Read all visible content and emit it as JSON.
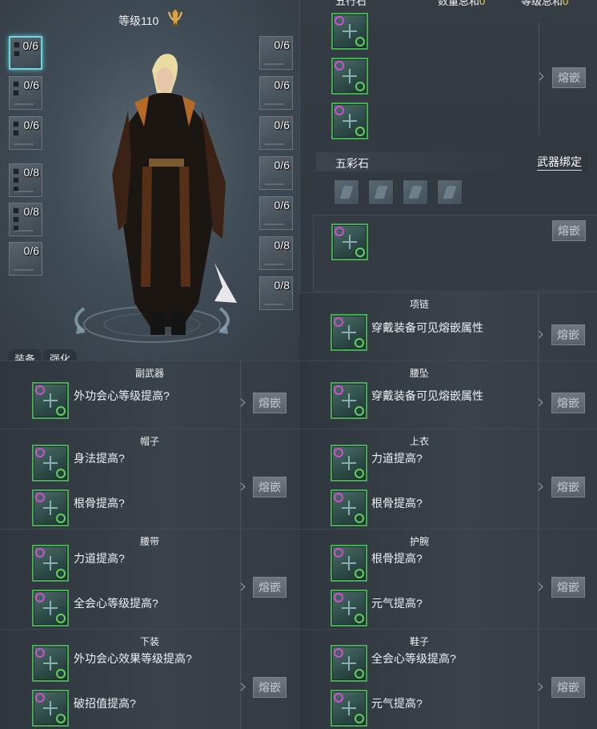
{
  "character": {
    "level_label": "等级110",
    "tabs": [
      "装备",
      "强化"
    ],
    "left_slots": [
      "0/6",
      "0/6",
      "0/6",
      "0/8",
      "0/8",
      "0/6"
    ],
    "right_slots": [
      "0/6",
      "0/6",
      "0/6",
      "0/6",
      "0/6",
      "0/8",
      "0/8"
    ]
  },
  "gem_panel": {
    "five_element_header": "五行石",
    "count_label": "数量总和",
    "count_value": "0",
    "level_label": "等级总和",
    "level_value": "0",
    "five_color_header": "五彩石",
    "weapon_bind_label": "武器绑定"
  },
  "inlay_button_label": "熔嵌",
  "cards": {
    "necklace": {
      "title": "项链",
      "line1": "穿戴装备可见熔嵌属性"
    },
    "waist_pendant": {
      "title": "腰坠",
      "line1": "穿戴装备可见熔嵌属性"
    },
    "offhand": {
      "title": "副武器",
      "line1": "外功会心等级提高?"
    },
    "hat": {
      "title": "帽子",
      "line1": "身法提高?",
      "line2": "根骨提高?"
    },
    "top": {
      "title": "上衣",
      "line1": "力道提高?",
      "line2": "根骨提高?"
    },
    "belt": {
      "title": "腰带",
      "line1": "力道提高?",
      "line2": "全会心等级提高?"
    },
    "bracer": {
      "title": "护腕",
      "line1": "根骨提高?",
      "line2": "元气提高?"
    },
    "pants": {
      "title": "下装",
      "line1": "外功会心效果等级提高?",
      "line2": "破招值提高?"
    },
    "shoes": {
      "title": "鞋子",
      "line1": "全会心等级提高?",
      "line2": "元气提高?"
    }
  },
  "colors": {
    "slot_border_green": "#49a956",
    "selected_slot_border": "#6fd3e0",
    "count_highlight": "#e7d35a"
  }
}
